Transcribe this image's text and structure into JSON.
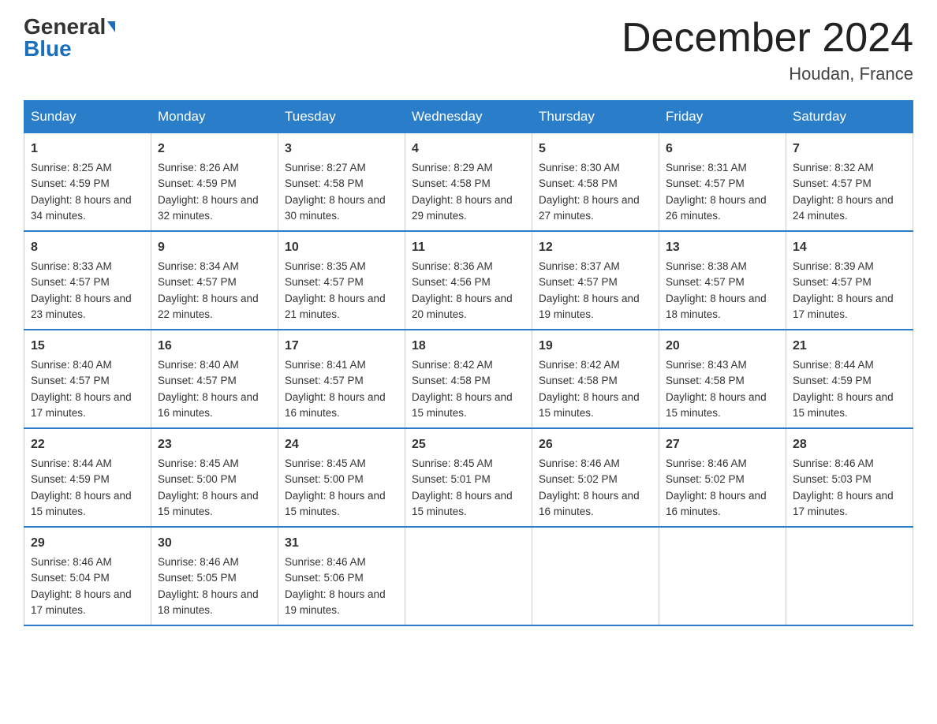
{
  "header": {
    "logo_general": "General",
    "logo_blue": "Blue",
    "month_title": "December 2024",
    "location": "Houdan, France"
  },
  "days_of_week": [
    "Sunday",
    "Monday",
    "Tuesday",
    "Wednesday",
    "Thursday",
    "Friday",
    "Saturday"
  ],
  "weeks": [
    [
      {
        "day": 1,
        "sunrise": "Sunrise: 8:25 AM",
        "sunset": "Sunset: 4:59 PM",
        "daylight": "Daylight: 8 hours and 34 minutes."
      },
      {
        "day": 2,
        "sunrise": "Sunrise: 8:26 AM",
        "sunset": "Sunset: 4:59 PM",
        "daylight": "Daylight: 8 hours and 32 minutes."
      },
      {
        "day": 3,
        "sunrise": "Sunrise: 8:27 AM",
        "sunset": "Sunset: 4:58 PM",
        "daylight": "Daylight: 8 hours and 30 minutes."
      },
      {
        "day": 4,
        "sunrise": "Sunrise: 8:29 AM",
        "sunset": "Sunset: 4:58 PM",
        "daylight": "Daylight: 8 hours and 29 minutes."
      },
      {
        "day": 5,
        "sunrise": "Sunrise: 8:30 AM",
        "sunset": "Sunset: 4:58 PM",
        "daylight": "Daylight: 8 hours and 27 minutes."
      },
      {
        "day": 6,
        "sunrise": "Sunrise: 8:31 AM",
        "sunset": "Sunset: 4:57 PM",
        "daylight": "Daylight: 8 hours and 26 minutes."
      },
      {
        "day": 7,
        "sunrise": "Sunrise: 8:32 AM",
        "sunset": "Sunset: 4:57 PM",
        "daylight": "Daylight: 8 hours and 24 minutes."
      }
    ],
    [
      {
        "day": 8,
        "sunrise": "Sunrise: 8:33 AM",
        "sunset": "Sunset: 4:57 PM",
        "daylight": "Daylight: 8 hours and 23 minutes."
      },
      {
        "day": 9,
        "sunrise": "Sunrise: 8:34 AM",
        "sunset": "Sunset: 4:57 PM",
        "daylight": "Daylight: 8 hours and 22 minutes."
      },
      {
        "day": 10,
        "sunrise": "Sunrise: 8:35 AM",
        "sunset": "Sunset: 4:57 PM",
        "daylight": "Daylight: 8 hours and 21 minutes."
      },
      {
        "day": 11,
        "sunrise": "Sunrise: 8:36 AM",
        "sunset": "Sunset: 4:56 PM",
        "daylight": "Daylight: 8 hours and 20 minutes."
      },
      {
        "day": 12,
        "sunrise": "Sunrise: 8:37 AM",
        "sunset": "Sunset: 4:57 PM",
        "daylight": "Daylight: 8 hours and 19 minutes."
      },
      {
        "day": 13,
        "sunrise": "Sunrise: 8:38 AM",
        "sunset": "Sunset: 4:57 PM",
        "daylight": "Daylight: 8 hours and 18 minutes."
      },
      {
        "day": 14,
        "sunrise": "Sunrise: 8:39 AM",
        "sunset": "Sunset: 4:57 PM",
        "daylight": "Daylight: 8 hours and 17 minutes."
      }
    ],
    [
      {
        "day": 15,
        "sunrise": "Sunrise: 8:40 AM",
        "sunset": "Sunset: 4:57 PM",
        "daylight": "Daylight: 8 hours and 17 minutes."
      },
      {
        "day": 16,
        "sunrise": "Sunrise: 8:40 AM",
        "sunset": "Sunset: 4:57 PM",
        "daylight": "Daylight: 8 hours and 16 minutes."
      },
      {
        "day": 17,
        "sunrise": "Sunrise: 8:41 AM",
        "sunset": "Sunset: 4:57 PM",
        "daylight": "Daylight: 8 hours and 16 minutes."
      },
      {
        "day": 18,
        "sunrise": "Sunrise: 8:42 AM",
        "sunset": "Sunset: 4:58 PM",
        "daylight": "Daylight: 8 hours and 15 minutes."
      },
      {
        "day": 19,
        "sunrise": "Sunrise: 8:42 AM",
        "sunset": "Sunset: 4:58 PM",
        "daylight": "Daylight: 8 hours and 15 minutes."
      },
      {
        "day": 20,
        "sunrise": "Sunrise: 8:43 AM",
        "sunset": "Sunset: 4:58 PM",
        "daylight": "Daylight: 8 hours and 15 minutes."
      },
      {
        "day": 21,
        "sunrise": "Sunrise: 8:44 AM",
        "sunset": "Sunset: 4:59 PM",
        "daylight": "Daylight: 8 hours and 15 minutes."
      }
    ],
    [
      {
        "day": 22,
        "sunrise": "Sunrise: 8:44 AM",
        "sunset": "Sunset: 4:59 PM",
        "daylight": "Daylight: 8 hours and 15 minutes."
      },
      {
        "day": 23,
        "sunrise": "Sunrise: 8:45 AM",
        "sunset": "Sunset: 5:00 PM",
        "daylight": "Daylight: 8 hours and 15 minutes."
      },
      {
        "day": 24,
        "sunrise": "Sunrise: 8:45 AM",
        "sunset": "Sunset: 5:00 PM",
        "daylight": "Daylight: 8 hours and 15 minutes."
      },
      {
        "day": 25,
        "sunrise": "Sunrise: 8:45 AM",
        "sunset": "Sunset: 5:01 PM",
        "daylight": "Daylight: 8 hours and 15 minutes."
      },
      {
        "day": 26,
        "sunrise": "Sunrise: 8:46 AM",
        "sunset": "Sunset: 5:02 PM",
        "daylight": "Daylight: 8 hours and 16 minutes."
      },
      {
        "day": 27,
        "sunrise": "Sunrise: 8:46 AM",
        "sunset": "Sunset: 5:02 PM",
        "daylight": "Daylight: 8 hours and 16 minutes."
      },
      {
        "day": 28,
        "sunrise": "Sunrise: 8:46 AM",
        "sunset": "Sunset: 5:03 PM",
        "daylight": "Daylight: 8 hours and 17 minutes."
      }
    ],
    [
      {
        "day": 29,
        "sunrise": "Sunrise: 8:46 AM",
        "sunset": "Sunset: 5:04 PM",
        "daylight": "Daylight: 8 hours and 17 minutes."
      },
      {
        "day": 30,
        "sunrise": "Sunrise: 8:46 AM",
        "sunset": "Sunset: 5:05 PM",
        "daylight": "Daylight: 8 hours and 18 minutes."
      },
      {
        "day": 31,
        "sunrise": "Sunrise: 8:46 AM",
        "sunset": "Sunset: 5:06 PM",
        "daylight": "Daylight: 8 hours and 19 minutes."
      },
      null,
      null,
      null,
      null
    ]
  ]
}
